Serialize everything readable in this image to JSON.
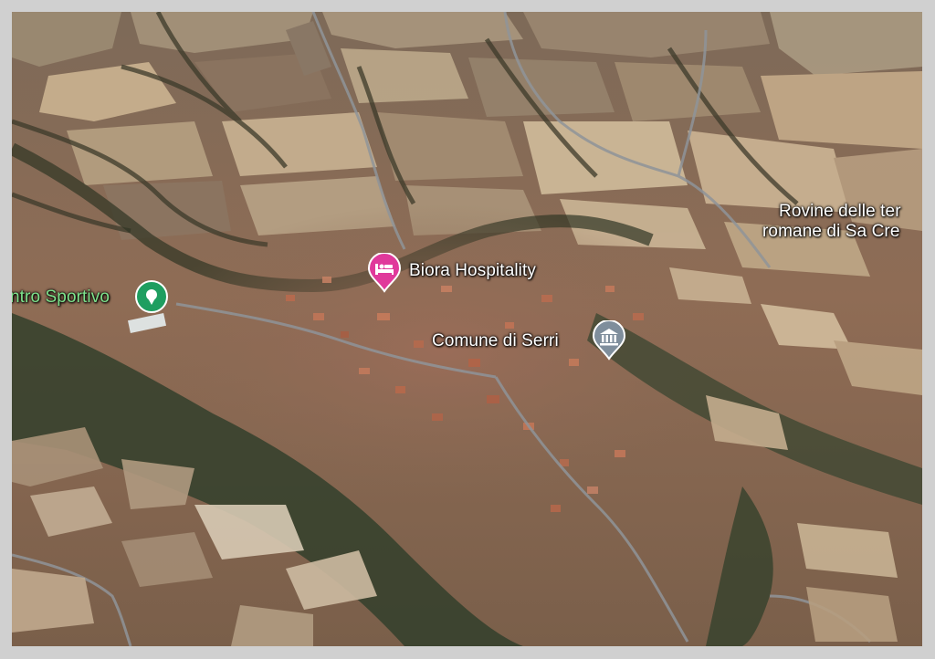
{
  "map": {
    "type": "satellite-3d",
    "place": "Serri",
    "colors": {
      "hotel_pin": "#e0399b",
      "sports_pin": "#1e9e60",
      "civic_pin": "#7f8e9c",
      "frame": "#d0d0d0"
    }
  },
  "places": [
    {
      "id": "sports",
      "label": "ntro Sportivo",
      "icon": "map-pin-icon",
      "category": "sports center"
    },
    {
      "id": "hotel",
      "label": "Biora Hospitality",
      "icon": "hotel-bed-icon",
      "category": "lodging"
    },
    {
      "id": "comune",
      "label": "Comune di Serri",
      "icon": "town-hall-icon",
      "category": "government"
    },
    {
      "id": "rovine",
      "label_line1": "Rovine delle ter",
      "label_line2": "romane di Sa Cre",
      "category": "historic site"
    }
  ]
}
